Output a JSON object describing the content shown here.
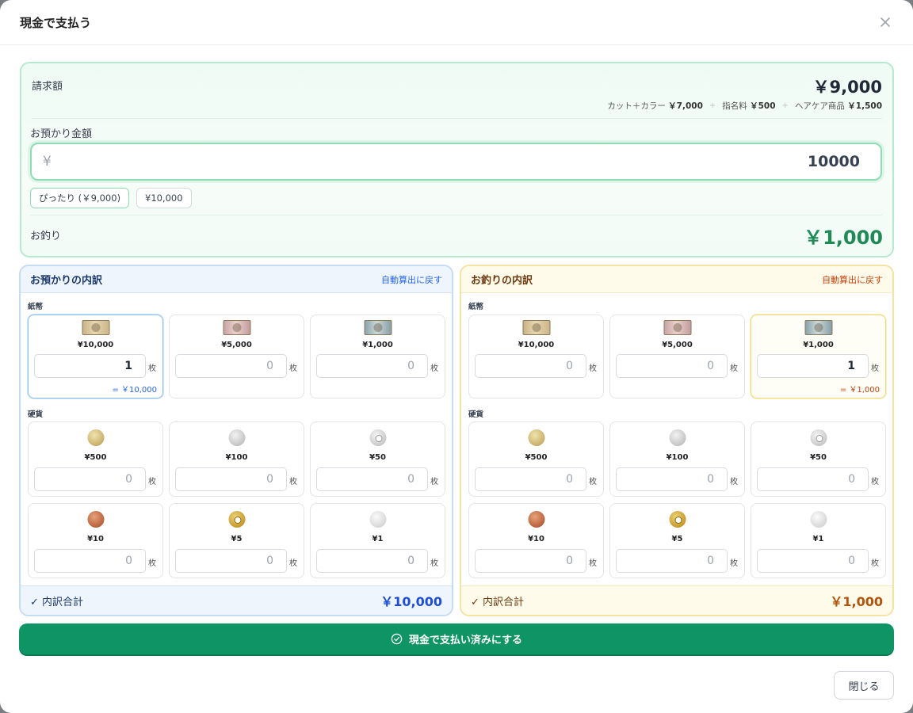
{
  "dialog": {
    "title": "現金で支払う",
    "close_label": "閉じる"
  },
  "summary": {
    "bill_label": "請求額",
    "bill_amount": "￥9,000",
    "items": [
      {
        "name": "カット＋カラー",
        "price": "￥7,000"
      },
      {
        "name": "指名料",
        "price": "￥500"
      },
      {
        "name": "ヘアケア商品",
        "price": "￥1,500"
      }
    ],
    "item_separator": "+",
    "tendered_label": "お預かり金額",
    "currency_symbol": "¥",
    "tendered_value": "10000",
    "quick_exact": "ぴったり (￥9,000)",
    "quick_10000": "¥10,000",
    "change_label": "お釣り",
    "change_amount": "￥1,000"
  },
  "labels": {
    "bills": "紙幣",
    "coins": "硬貨",
    "unit": "枚",
    "total_check": "✓",
    "total_label": "内訳合計"
  },
  "tendered_panel": {
    "title": "お預かりの内訳",
    "reset_label": "自動算出に戻す",
    "bills": [
      {
        "label": "¥10,000",
        "qty": "1",
        "subtotal": "= ￥10,000"
      },
      {
        "label": "¥5,000",
        "qty": "0",
        "subtotal": ""
      },
      {
        "label": "¥1,000",
        "qty": "0",
        "subtotal": ""
      }
    ],
    "coins": [
      {
        "label": "¥500",
        "qty": "0"
      },
      {
        "label": "¥100",
        "qty": "0"
      },
      {
        "label": "¥50",
        "qty": "0"
      },
      {
        "label": "¥10",
        "qty": "0"
      },
      {
        "label": "¥5",
        "qty": "0"
      },
      {
        "label": "¥1",
        "qty": "0"
      }
    ],
    "total": "￥10,000"
  },
  "change_panel": {
    "title": "お釣りの内訳",
    "reset_label": "自動算出に戻す",
    "bills": [
      {
        "label": "¥10,000",
        "qty": "0",
        "subtotal": ""
      },
      {
        "label": "¥5,000",
        "qty": "0",
        "subtotal": ""
      },
      {
        "label": "¥1,000",
        "qty": "1",
        "subtotal": "= ￥1,000"
      }
    ],
    "coins": [
      {
        "label": "¥500",
        "qty": "0"
      },
      {
        "label": "¥100",
        "qty": "0"
      },
      {
        "label": "¥50",
        "qty": "0"
      },
      {
        "label": "¥10",
        "qty": "0"
      },
      {
        "label": "¥5",
        "qty": "0"
      },
      {
        "label": "¥1",
        "qty": "0"
      }
    ],
    "total": "￥1,000"
  },
  "actions": {
    "pay_label": "現金で支払い済みにする"
  },
  "colors": {
    "primary_green": "#0f9466",
    "change_green": "#1f8a56",
    "tendered_blue": "#1d4ed8",
    "change_amber": "#b45309"
  }
}
